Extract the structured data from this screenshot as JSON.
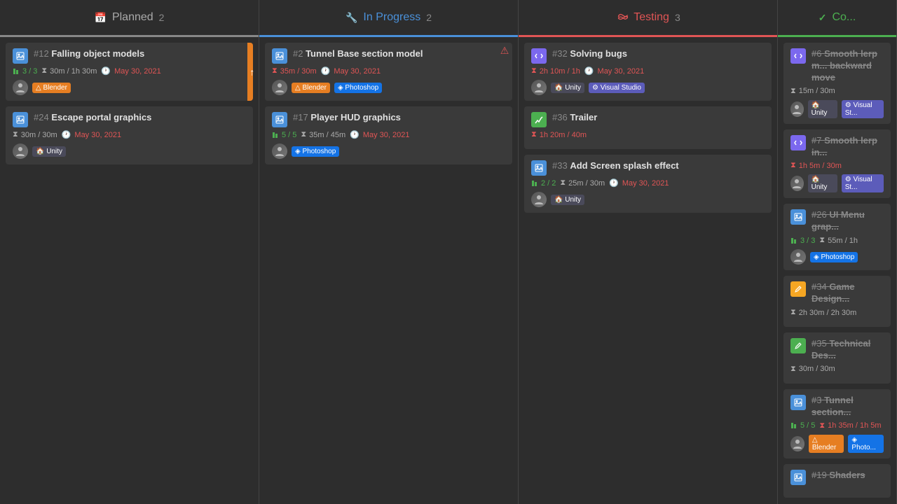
{
  "columns": [
    {
      "id": "planned",
      "label": "Planned",
      "count": "2",
      "icon": "📅",
      "dividerColor": "#888",
      "cards": [
        {
          "id": "c12",
          "num": "#12",
          "title": "Falling object models",
          "iconType": "image",
          "tasks": "3 / 3",
          "time": "30m / 1h 30m",
          "timeOver": false,
          "date": "May 30, 2021",
          "dateOver": true,
          "tags": [
            "Blender"
          ],
          "hasOrangeFlag": true
        },
        {
          "id": "c24",
          "num": "#24",
          "title": "Escape portal graphics",
          "iconType": "image",
          "tasks": null,
          "time": "30m / 30m",
          "timeOver": false,
          "date": "May 30, 2021",
          "dateOver": true,
          "tags": [
            "Unity"
          ],
          "hasOrangeFlag": false
        }
      ]
    },
    {
      "id": "inprogress",
      "label": "In Progress",
      "count": "2",
      "icon": "🔧",
      "dividerColor": "#4a90d9",
      "cards": [
        {
          "id": "c2",
          "num": "#2",
          "title": "Tunnel Base section model",
          "iconType": "image",
          "tasks": null,
          "time": "35m / 30m",
          "timeOver": true,
          "date": "May 30, 2021",
          "dateOver": true,
          "tags": [
            "Blender",
            "Photoshop"
          ],
          "hasWarning": true
        },
        {
          "id": "c17",
          "num": "#17",
          "title": "Player HUD graphics",
          "iconType": "image",
          "tasks": "5 / 5",
          "time": "35m / 45m",
          "timeOver": false,
          "date": "May 30, 2021",
          "dateOver": true,
          "tags": [
            "Photoshop"
          ],
          "hasWarning": false
        }
      ]
    },
    {
      "id": "testing",
      "label": "Testing",
      "count": "3",
      "icon": "🔗",
      "dividerColor": "#e05555",
      "cards": [
        {
          "id": "c32",
          "num": "#32",
          "title": "Solving bugs",
          "iconType": "code",
          "tasks": null,
          "time": "2h 10m / 1h",
          "timeOver": true,
          "date": "May 30, 2021",
          "dateOver": true,
          "tags": [
            "Unity",
            "Visual Studio"
          ]
        },
        {
          "id": "c36",
          "num": "#36",
          "title": "Trailer",
          "iconType": "chart",
          "tasks": null,
          "time": "1h 20m / 40m",
          "timeOver": true,
          "date": null,
          "dateOver": false,
          "tags": []
        },
        {
          "id": "c33",
          "num": "#33",
          "title": "Add Screen splash effect",
          "iconType": "image",
          "tasks": "2 / 2",
          "time": "25m / 30m",
          "timeOver": false,
          "date": "May 30, 2021",
          "dateOver": true,
          "tags": [
            "Unity"
          ]
        }
      ]
    },
    {
      "id": "complete",
      "label": "Co...",
      "count": "",
      "icon": "✓",
      "dividerColor": "#4caf50",
      "cards": [
        {
          "id": "c6",
          "num": "#6",
          "title": "Smooth lerp m... backward move",
          "iconType": "code",
          "tasks": null,
          "time": "15m / 30m",
          "timeOver": false,
          "date": null,
          "tags": [
            "Unity",
            "Visual St..."
          ],
          "strikethrough": true
        },
        {
          "id": "c7",
          "num": "#7",
          "title": "Smooth lerp in...",
          "iconType": "code",
          "tasks": null,
          "time": "1h 5m / 30m",
          "timeOver": true,
          "date": null,
          "tags": [
            "Unity",
            "Visual St..."
          ],
          "strikethrough": true
        },
        {
          "id": "c26",
          "num": "#26",
          "title": "UI Menu grap...",
          "iconType": "image",
          "tasks": "3 / 3",
          "time": "55m / 1h",
          "timeOver": false,
          "date": null,
          "tags": [
            "Photoshop"
          ],
          "strikethrough": true
        },
        {
          "id": "c34",
          "num": "#34",
          "title": "Game Design...",
          "iconType": "pencil",
          "tasks": null,
          "time": "2h 30m / 2h 30m",
          "timeOver": false,
          "date": null,
          "tags": [],
          "strikethrough": true
        },
        {
          "id": "c35",
          "num": "#35",
          "title": "Technical Des...",
          "iconType": "pencil2",
          "tasks": null,
          "time": "30m / 30m",
          "timeOver": false,
          "date": null,
          "tags": [],
          "strikethrough": true
        },
        {
          "id": "c3",
          "num": "#3",
          "title": "Tunnel section...",
          "iconType": "image",
          "tasks": "5 / 5",
          "time": "1h 35m / 1h 5m",
          "timeOver": true,
          "date": null,
          "tags": [
            "Blender",
            "Photo..."
          ],
          "strikethrough": true
        },
        {
          "id": "c19",
          "num": "#19",
          "title": "Shaders",
          "iconType": "image",
          "tasks": null,
          "time": null,
          "timeOver": false,
          "date": null,
          "tags": [],
          "strikethrough": true
        }
      ]
    }
  ],
  "tags": {
    "Unity": {
      "label": "Unity",
      "class": "tag-unity",
      "icon": "🏠"
    },
    "Blender": {
      "label": "Blender",
      "class": "tag-blender",
      "icon": "🔼"
    },
    "Photoshop": {
      "label": "Photoshop",
      "class": "tag-photoshop",
      "icon": "🖼"
    },
    "Photo...": {
      "label": "Photo...",
      "class": "tag-photoshop",
      "icon": "🖼"
    },
    "Visual Studio": {
      "label": "Visual Studio",
      "class": "tag-vstudio",
      "icon": "⚙"
    },
    "Visual St...": {
      "label": "Visual St...",
      "class": "tag-vstudio",
      "icon": "⚙"
    }
  }
}
